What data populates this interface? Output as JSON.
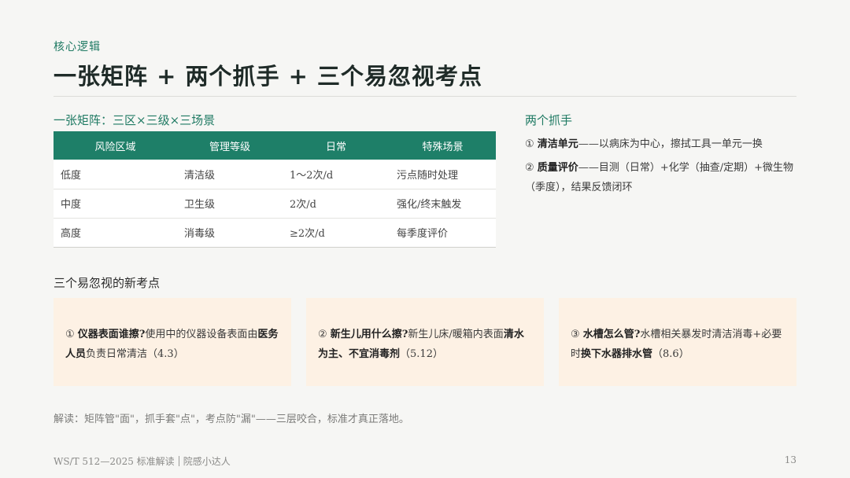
{
  "header": {
    "kicker": "核心逻辑",
    "title": "一张矩阵 + 两个抓手 + 三个易忽视考点"
  },
  "matrix": {
    "heading": "一张矩阵：三区×三级×三场景",
    "columns": [
      "风险区域",
      "管理等级",
      "日常",
      "特殊场景"
    ],
    "rows": [
      [
        "低度",
        "清洁级",
        "1～2次/d",
        "污点随时处理"
      ],
      [
        "中度",
        "卫生级",
        "2次/d",
        "强化/终末触发"
      ],
      [
        "高度",
        "消毒级",
        "≥2次/d",
        "每季度评价"
      ]
    ]
  },
  "grips": {
    "heading": "两个抓手",
    "items": [
      {
        "num": "①",
        "bold": "清洁单元",
        "text": "——以病床为中心，擦拭工具一单元一换"
      },
      {
        "num": "②",
        "bold": "质量评价",
        "text": "——目测（日常）+化学（抽查/定期）+微生物（季度），结果反馈闭环"
      }
    ]
  },
  "neglected": {
    "heading": "三个易忽视的新考点",
    "cards": [
      {
        "num": "①",
        "q": "仪器表面谁擦?",
        "t1": "使用中的仪器设备表面由",
        "b1": "医务人员",
        "t2": "负责日常清洁（4.3）",
        "b2": ""
      },
      {
        "num": "②",
        "q": "新生儿用什么擦?",
        "t1": "新生儿床/暖箱内表面",
        "b1": "清水为主、不宜消毒剂",
        "t2": "（5.12）",
        "b2": ""
      },
      {
        "num": "③",
        "q": "水槽怎么管?",
        "t1": "水槽相关暴发时清洁消毒+必要时",
        "b1": "换下水器排水管",
        "t2": "（8.6）",
        "b2": ""
      }
    ]
  },
  "note": "解读：矩阵管\"面\"，抓手套\"点\"，考点防\"漏\"——三层咬合，标准才真正落地。",
  "footer": {
    "doc": "WS/T 512—2025 标准解读",
    "brand": "院感小达人",
    "page": "13"
  },
  "colors": {
    "accent": "#1f7a63",
    "table_header": "#1e7f68",
    "card_bg": "#fdf1e4"
  }
}
